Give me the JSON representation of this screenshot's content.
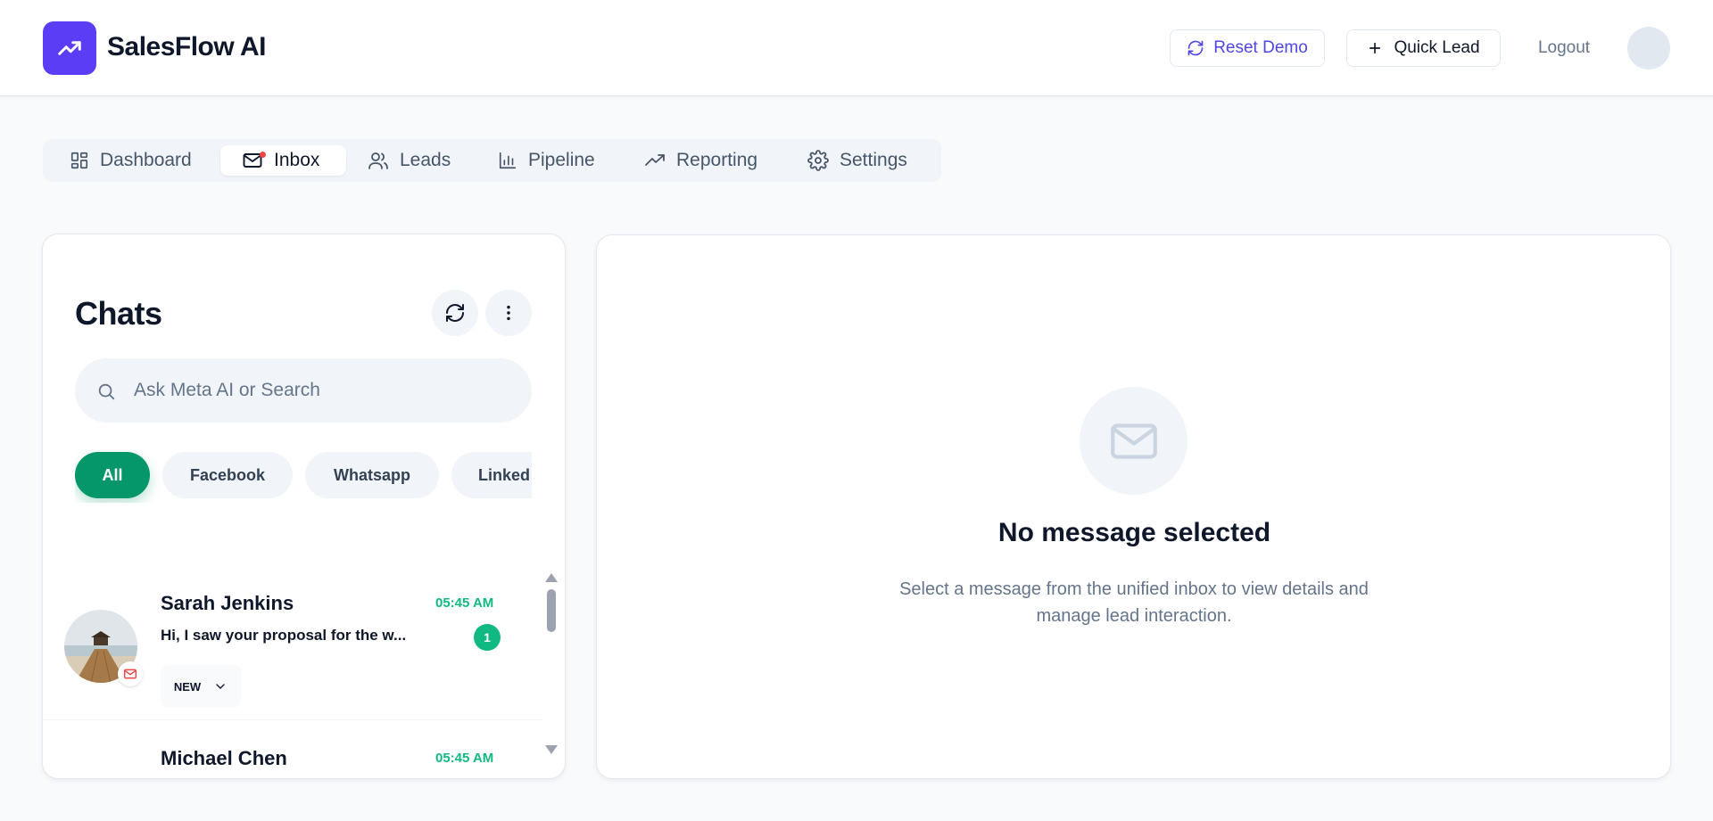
{
  "header": {
    "brand": "SalesFlow AI",
    "reset_label": "Reset Demo",
    "quick_lead_label": "Quick Lead",
    "logout_label": "Logout"
  },
  "nav": {
    "items": [
      {
        "label": "Dashboard",
        "icon": "dashboard-icon"
      },
      {
        "label": "Inbox",
        "icon": "mail-icon",
        "active": true,
        "notification": true
      },
      {
        "label": "Leads",
        "icon": "users-icon"
      },
      {
        "label": "Pipeline",
        "icon": "bar-chart-icon"
      },
      {
        "label": "Reporting",
        "icon": "trending-up-icon"
      },
      {
        "label": "Settings",
        "icon": "gear-icon"
      }
    ]
  },
  "chats": {
    "title": "Chats",
    "search_placeholder": "Ask Meta AI or Search",
    "filters": [
      "All",
      "Facebook",
      "Whatsapp",
      "Linked"
    ],
    "active_filter": "All",
    "items": [
      {
        "name": "Sarah Jenkins",
        "time": "05:45 AM",
        "preview": "Hi, I saw your proposal for the w...",
        "unread": "1",
        "status": "NEW",
        "channel_icon": "mail-icon"
      },
      {
        "name": "Michael Chen",
        "time": "05:45 AM"
      }
    ]
  },
  "detail": {
    "empty_title": "No message selected",
    "empty_description": "Select a message from the unified inbox to view details and manage lead interaction."
  },
  "colors": {
    "brand": "#5b3df5",
    "accent_green": "#059669",
    "time_green": "#10b981",
    "reset_text": "#4f46e5",
    "notification_red": "#ef4444"
  }
}
